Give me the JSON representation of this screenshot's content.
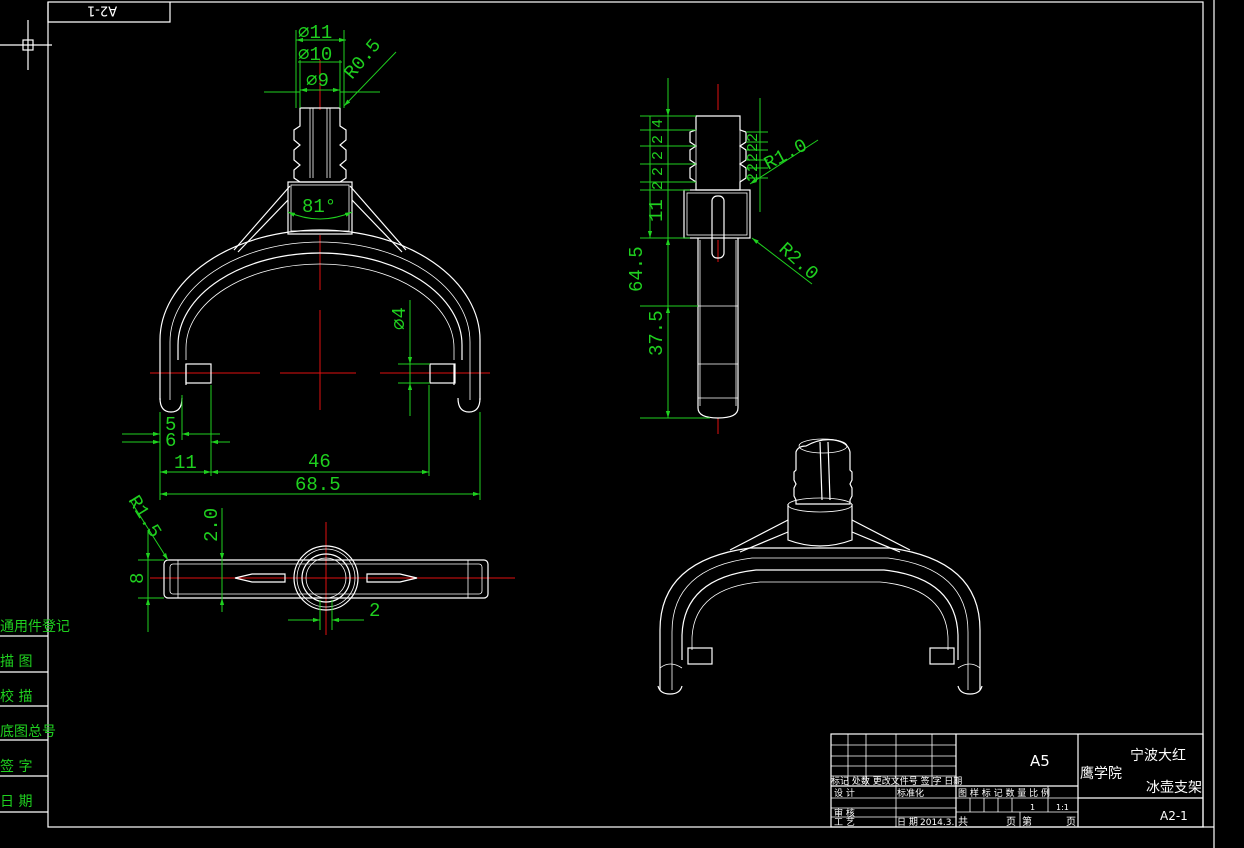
{
  "corner_label": "A2-1",
  "front_view": {
    "dims": {
      "d11": "⌀11",
      "d10": "⌀10",
      "d9": "⌀9",
      "r05": "R0.5",
      "angle": "81°",
      "d4": "⌀4",
      "dim5": "5",
      "dim6": "6",
      "dim11": "11",
      "dim46": "46",
      "dim685": "68.5"
    }
  },
  "bottom_view": {
    "dims": {
      "r15": "R1.5",
      "dim20": "2.0",
      "dim8": "8",
      "dim2": "2"
    }
  },
  "side_view": {
    "dims": {
      "small_stack": [
        "4",
        "2",
        "2",
        "2",
        "2"
      ],
      "right_stack": [
        "2",
        "2",
        "2",
        "2",
        "2"
      ],
      "dim11v": "11",
      "dim645": "64.5",
      "dim375": "37.5",
      "r10": "R1.0",
      "r20": "R2.0"
    }
  },
  "left_column": {
    "items": [
      "通用件登记",
      "描 图",
      "校 描",
      "底图总号",
      "签 字",
      "日 期"
    ]
  },
  "title_block": {
    "format": "A5",
    "school_line1": "宁波大红",
    "school_line2": "鹰学院",
    "part_name": "冰壶支架",
    "drawing_no": "A2-1",
    "rev_header": "标记 处数 更改文件号 签 字 日期",
    "design": "设 计",
    "standardize": "标准化",
    "stage_header": "图 样 标 记 数 量 比 例",
    "quantity": "1",
    "scale": "1:1",
    "review": "审 核",
    "process": "工 艺",
    "date_label": "日 期",
    "date_value": "2014.3.",
    "total_label": "共",
    "page_label": "页",
    "sheet_label": "第",
    "page_label2": "页"
  }
}
